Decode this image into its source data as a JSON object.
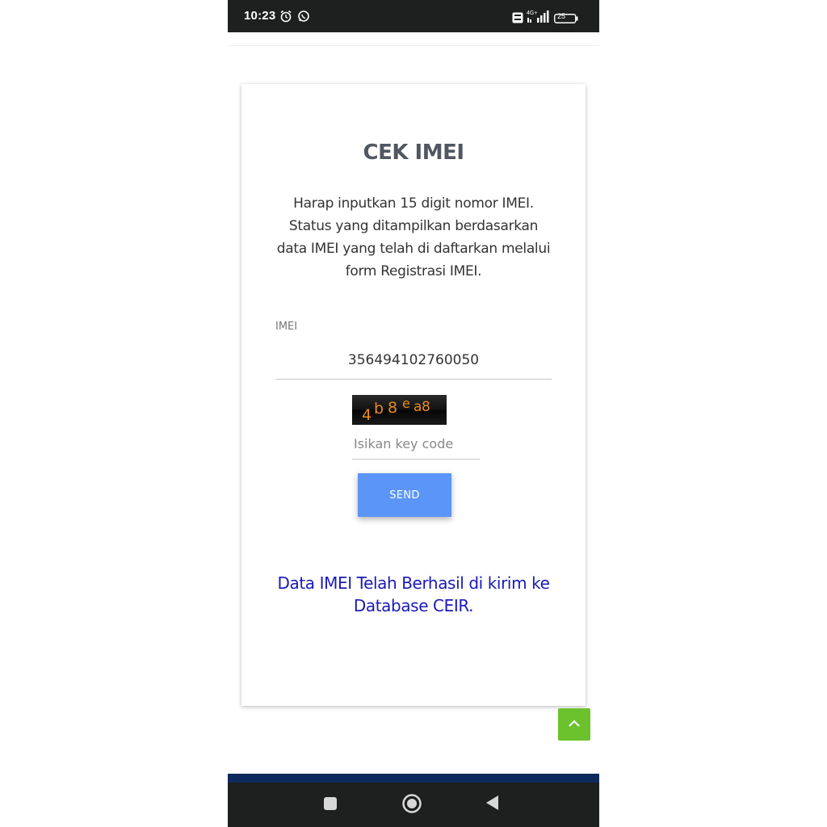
{
  "status_bar": {
    "time": "10:23",
    "battery": "25",
    "network": "4G+",
    "icons": [
      "alarm-icon",
      "whatsapp-icon",
      "volte-icon",
      "signal-icon",
      "battery-icon"
    ]
  },
  "card": {
    "title": "CEK IMEI",
    "instructions": "Harap inputkan 15 digit nomor IMEI. Status yang ditampilkan berdasarkan data IMEI yang telah di daftarkan melalui form Registrasi IMEI.",
    "imei": {
      "label": "IMEI",
      "value": "356494102760050"
    },
    "captcha": {
      "text": "4b8ea8"
    },
    "key_code": {
      "placeholder": "Isikan key code",
      "value": ""
    },
    "send_label": "SEND",
    "result_message": "Data IMEI Telah Berhasil di kirim ke Database CEIR."
  },
  "colors": {
    "send_button": "#5b95f7",
    "result_text": "#1a1ab8",
    "scroll_top": "#6cc22d",
    "footer": "#0d2a5c",
    "system_bars": "#1e1f1f"
  },
  "navigation": {
    "icons": [
      "recents-icon",
      "home-icon",
      "back-icon"
    ]
  }
}
